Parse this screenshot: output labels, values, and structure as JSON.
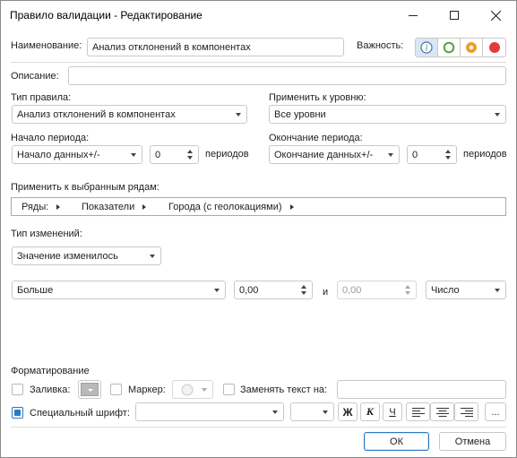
{
  "window": {
    "title": "Правило валидации - Редактирование",
    "minimize_glyph": "—",
    "maximize_glyph": "☐",
    "close_glyph": "✕"
  },
  "name": {
    "label": "Наименование:",
    "value": "Анализ отклонений в компонентах"
  },
  "importance": {
    "label": "Важность:",
    "options": [
      {
        "icon": "info-icon",
        "color": "#4a6fa5",
        "selected": true
      },
      {
        "icon": "green-circle-icon",
        "color": "#5aa33c"
      },
      {
        "icon": "orange-circle-icon",
        "color": "#f0a020"
      },
      {
        "icon": "red-circle-icon",
        "color": "#e23b3b"
      }
    ]
  },
  "description": {
    "label": "Описание:",
    "value": ""
  },
  "rule_type": {
    "label": "Тип правила:",
    "value": "Анализ отклонений в компонентах"
  },
  "apply_level": {
    "label": "Применить к уровню:",
    "value": "Все уровни"
  },
  "period_start": {
    "label": "Начало периода:",
    "mode": "Начало данных+/-",
    "count": "0",
    "unit": "периодов"
  },
  "period_end": {
    "label": "Окончание периода:",
    "mode": "Окончание данных+/-",
    "count": "0",
    "unit": "периодов"
  },
  "apply_rows": {
    "label": "Применить к выбранным рядам:",
    "crumbs": [
      "Ряды:",
      "Показатели",
      "Города (с геолокациями)"
    ]
  },
  "change_type": {
    "label": "Тип изменений:",
    "value": "Значение изменилось"
  },
  "condition": {
    "operator": "Больше",
    "value1": "0,00",
    "and_label": "и",
    "value2": "0,00",
    "value_type": "Число"
  },
  "formatting": {
    "label": "Форматирование",
    "fill_label": "Заливка:",
    "marker_label": "Маркер:",
    "replace_label": "Заменять текст на:",
    "replace_value": "",
    "special_font_label": "Специальный шрифт:",
    "font_family": "",
    "font_size": "",
    "bold": "Ж",
    "italic": "К",
    "underline": "Ч",
    "more": "..."
  },
  "buttons": {
    "ok": "ОК",
    "cancel": "Отмена"
  },
  "colors": {
    "accent": "#2b79c2"
  }
}
